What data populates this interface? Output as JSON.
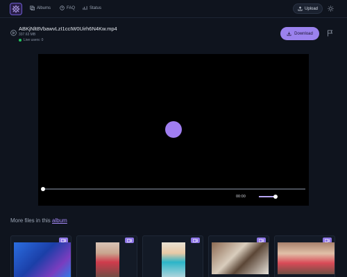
{
  "nav": {
    "albums_label": "Albums",
    "faq_label": "FAQ",
    "status_label": "Status",
    "upload_label": "Upload"
  },
  "file": {
    "name": "ABKjNlt8VbawvLzI1ccIW0Uirh6N4Kw.mp4",
    "size": "337.63 MB",
    "live_users": "Live users: 0",
    "download_label": "Download"
  },
  "player": {
    "time": "00:00",
    "progress": 0,
    "volume": 1
  },
  "more_files": {
    "prefix": "More files in this",
    "link_label": "album"
  },
  "colors": {
    "accent": "#9b82ee",
    "background": "#0f141e",
    "live": "#22c55e"
  },
  "icons": [
    "logo-icon",
    "albums-icon",
    "faq-icon",
    "status-icon",
    "upload-icon",
    "sun-icon",
    "play-circle-icon",
    "download-icon",
    "flag-icon",
    "video-icon"
  ]
}
